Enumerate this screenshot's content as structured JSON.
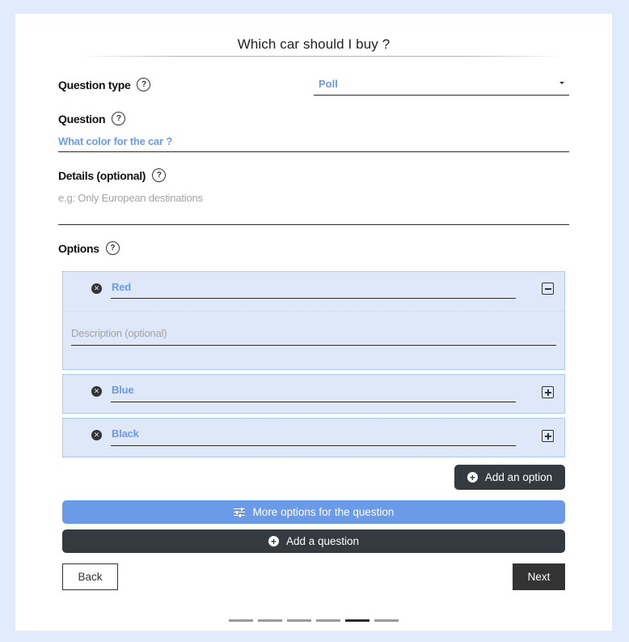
{
  "colors": {
    "page_bg": "#e0ebfc",
    "accent": "#6b9ae8",
    "dark": "#343a40",
    "option_bg": "#dfe8f8",
    "placeholder": "#a3a3a3"
  },
  "header": {
    "title": "Which car should I buy ?"
  },
  "form": {
    "question_type": {
      "label": "Question type",
      "help_icon": "question-circle-icon",
      "help_glyph": "?",
      "selected": "Poll",
      "caret_icon": "caret-down-icon"
    },
    "question": {
      "label": "Question",
      "help_glyph": "?",
      "value": "What color for the car ?"
    },
    "details": {
      "label": "Details (optional)",
      "help_glyph": "?",
      "value": "",
      "placeholder": "e.g: Only European destinations"
    },
    "options": {
      "label": "Options",
      "help_glyph": "?",
      "remove_glyph": "✕",
      "items": [
        {
          "name": "Red",
          "expanded": true,
          "toggle_icon": "collapse-minus-icon",
          "description_placeholder": "Description (optional)"
        },
        {
          "name": "Blue",
          "expanded": false,
          "toggle_icon": "expand-plus-icon"
        },
        {
          "name": "Black",
          "expanded": false,
          "toggle_icon": "expand-plus-icon"
        }
      ]
    }
  },
  "buttons": {
    "add_option": "Add an option",
    "more_options": "More options for the question",
    "add_question": "Add a question",
    "plus_glyph": "+",
    "back": "Back",
    "next": "Next"
  },
  "stepper": {
    "total_steps": 6,
    "current_step": 5
  }
}
